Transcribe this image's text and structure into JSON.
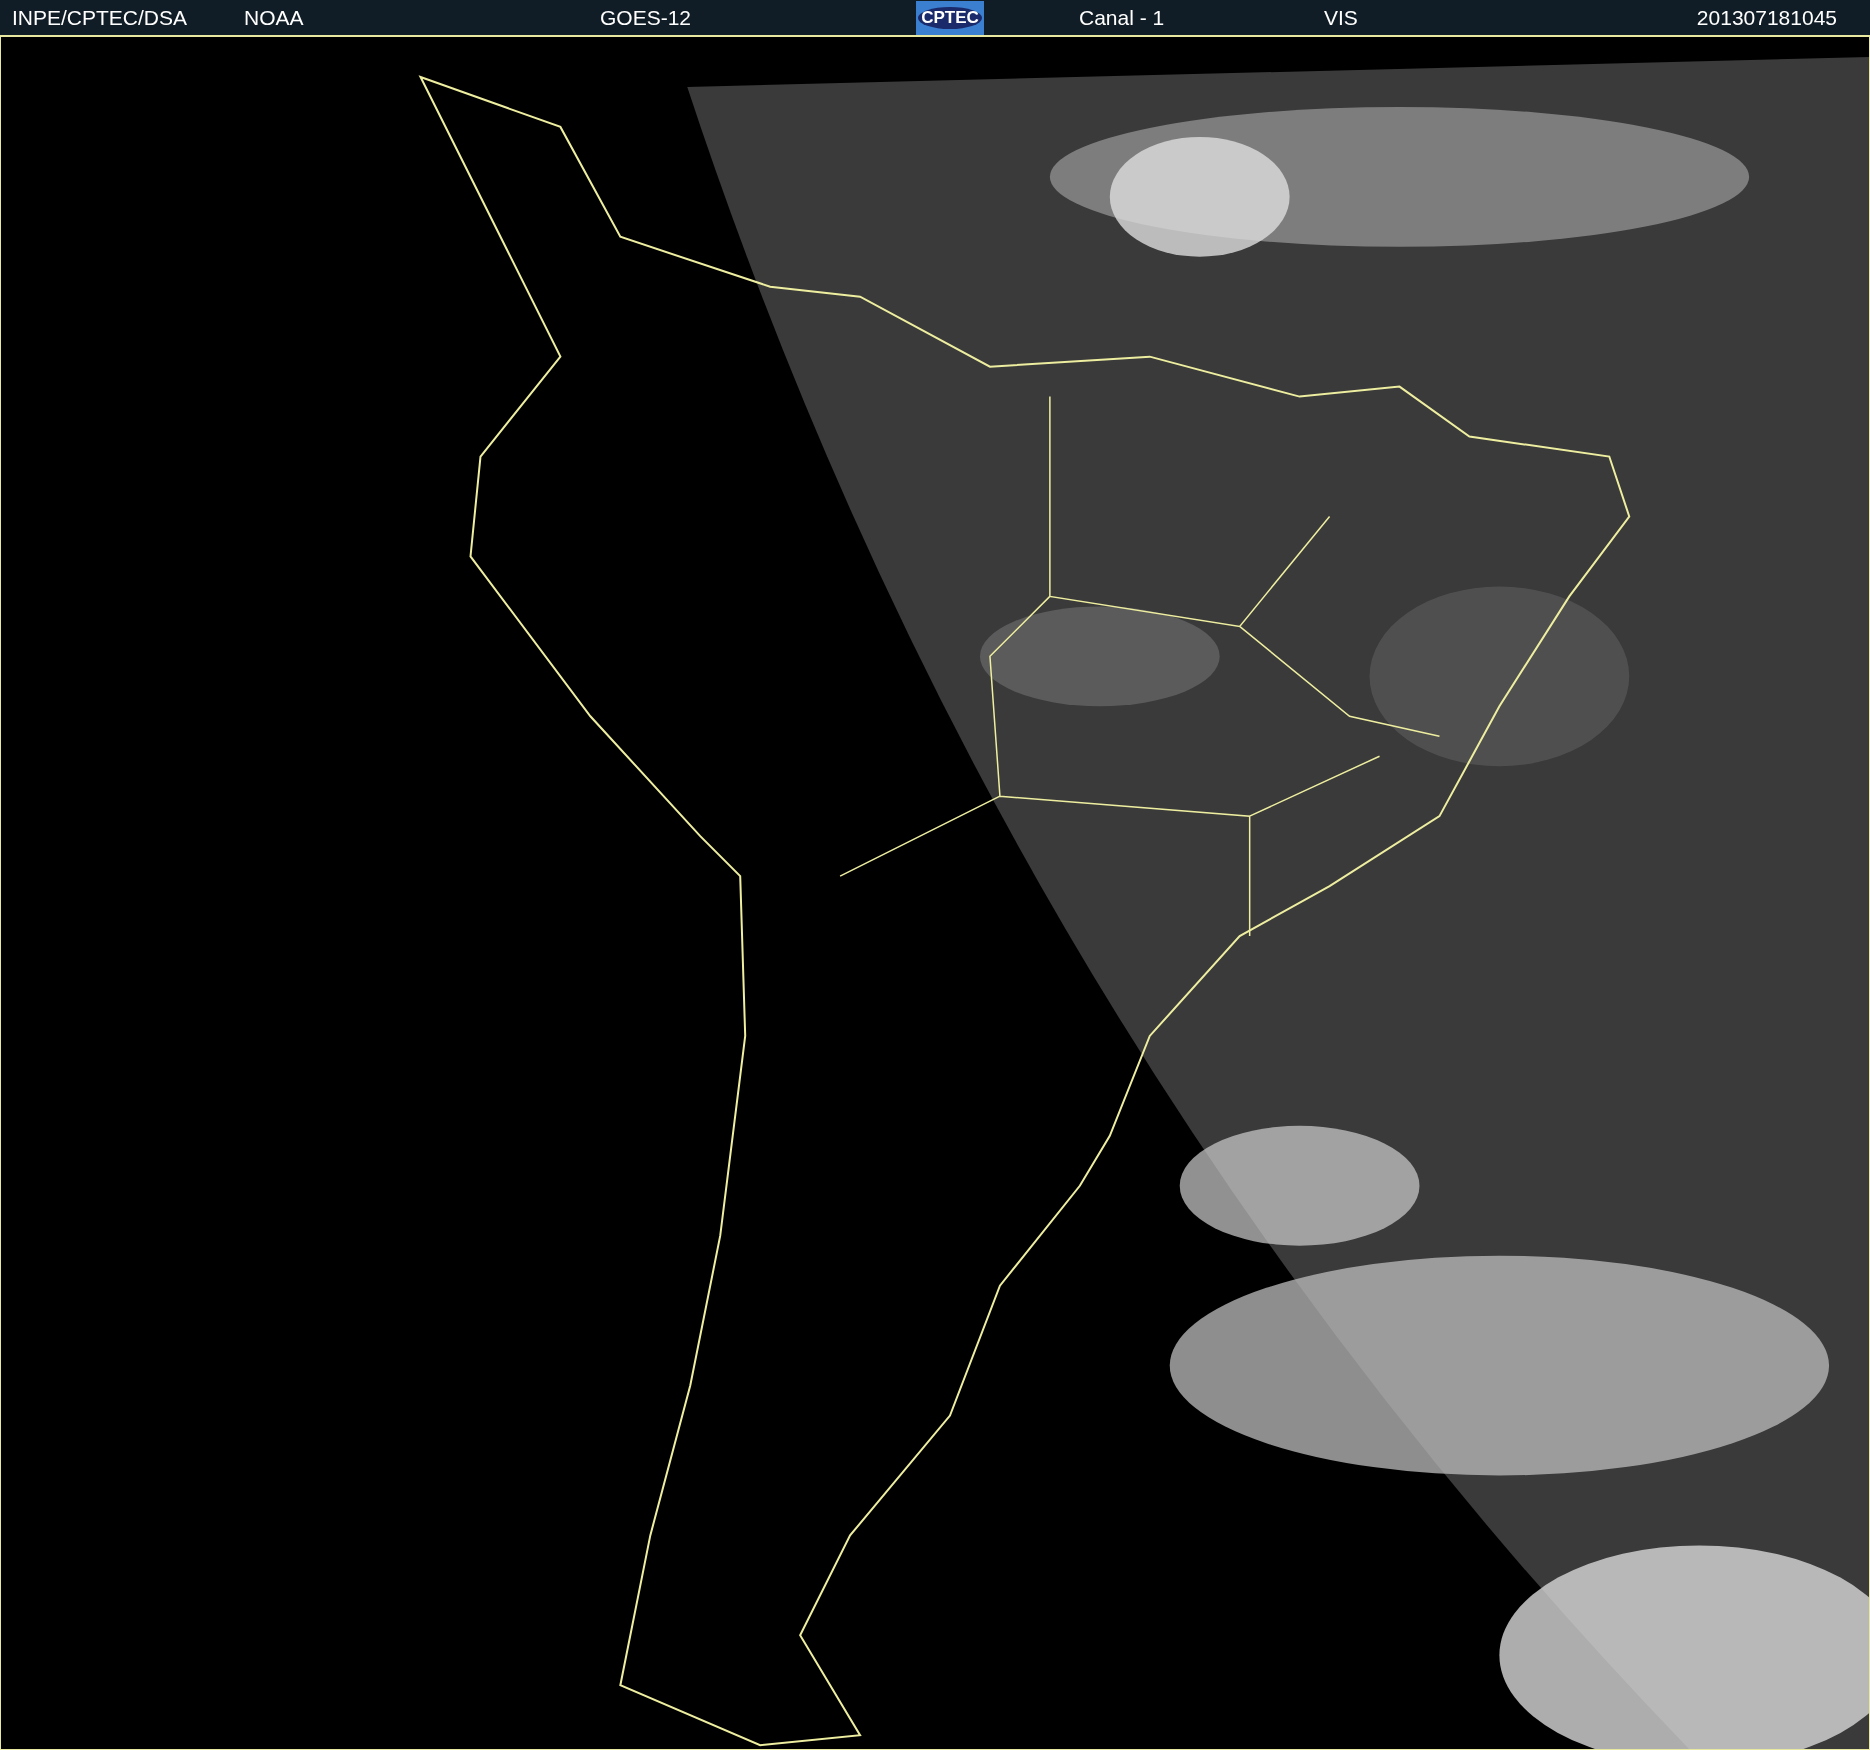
{
  "header": {
    "agency": "INPE/CPTEC/DSA",
    "source": "NOAA",
    "satellite": "GOES-12",
    "logo": "CPTEC",
    "channel": "Canal - 1",
    "band": "VIS",
    "timestamp": "201307181045"
  }
}
